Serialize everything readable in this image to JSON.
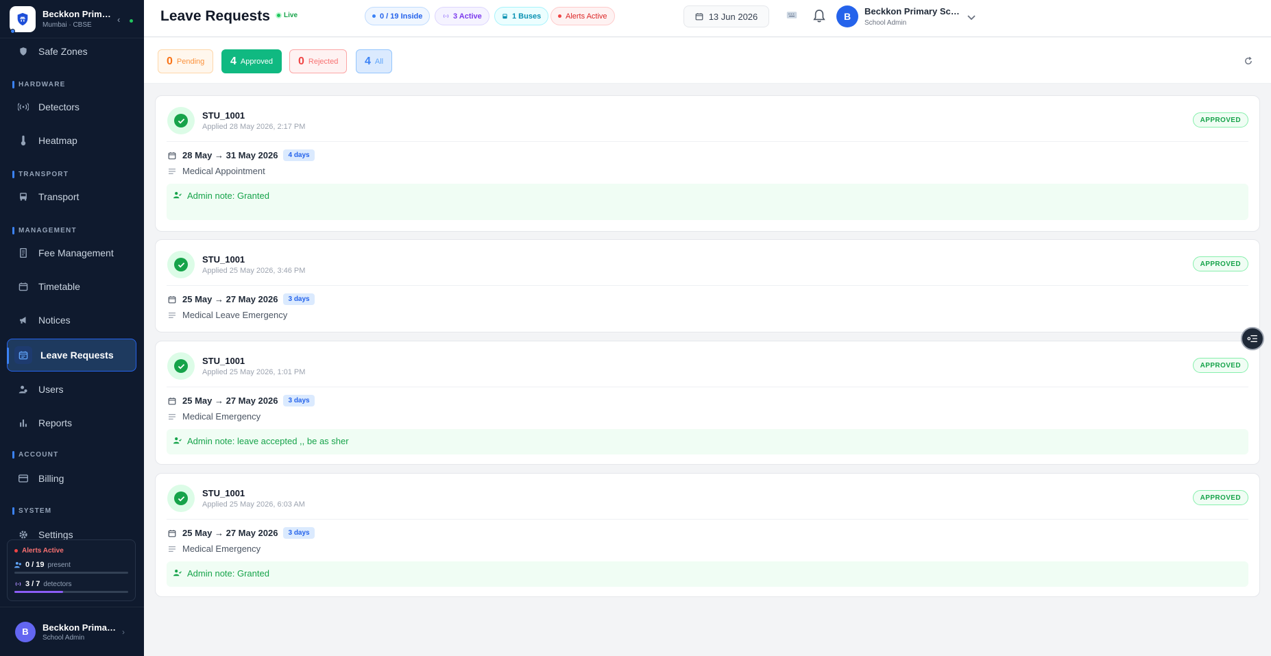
{
  "sidebar": {
    "school_name": "Beckkon Primary School",
    "school_meta": "Mumbai · CBSE",
    "sections": {
      "hardware": "HARDWARE",
      "transport": "TRANSPORT",
      "management": "MANAGEMENT",
      "account": "ACCOUNT",
      "system": "SYSTEM"
    },
    "items": {
      "safe_zones": "Safe Zones",
      "detectors": "Detectors",
      "heatmap": "Heatmap",
      "transport": "Transport",
      "fee_management": "Fee Management",
      "timetable": "Timetable",
      "notices": "Notices",
      "leave_requests": "Leave Requests",
      "users": "Users",
      "reports": "Reports",
      "billing": "Billing",
      "settings": "Settings"
    },
    "status": {
      "alert": "Alerts Active",
      "present_value": "0 / 19",
      "present_label": "present",
      "present_fraction": 0.0,
      "detectors_value": "3 / 7",
      "detectors_label": "detectors",
      "detectors_fraction": 0.43
    },
    "user": {
      "initial": "B",
      "name": "Beckkon Primary School",
      "role": "School Admin"
    }
  },
  "header": {
    "title": "Leave Requests",
    "live": "Live",
    "chips": {
      "inside": "0 / 19 Inside",
      "active": "3 Active",
      "buses": "1 Buses",
      "alerts": "Alerts Active"
    },
    "date": "13 Jun 2026",
    "user_initial": "B",
    "user_name": "Beckkon Primary School",
    "user_role": "School Admin"
  },
  "filters": {
    "pending": {
      "count": "0",
      "label": "Pending"
    },
    "approved": {
      "count": "4",
      "label": "Approved"
    },
    "rejected": {
      "count": "0",
      "label": "Rejected"
    },
    "all": {
      "count": "4",
      "label": "All"
    }
  },
  "requests": [
    {
      "student": "STU_1001",
      "applied": "Applied 28 May 2026, 2:17 PM",
      "status": "APPROVED",
      "dates": "28 May → 31 May 2026",
      "days": "4 days",
      "reason": "Medical Appointment",
      "note": "Admin note: Granted"
    },
    {
      "student": "STU_1001",
      "applied": "Applied 25 May 2026, 3:46 PM",
      "status": "APPROVED",
      "dates": "25 May → 27 May 2026",
      "days": "3 days",
      "reason": "Medical Leave Emergency",
      "note": ""
    },
    {
      "student": "STU_1001",
      "applied": "Applied 25 May 2026, 1:01 PM",
      "status": "APPROVED",
      "dates": "25 May → 27 May 2026",
      "days": "3 days",
      "reason": "Medical Emergency",
      "note": "Admin note: leave accepted ,, be as sher"
    },
    {
      "student": "STU_1001",
      "applied": "Applied 25 May 2026, 6:03 AM",
      "status": "APPROVED",
      "dates": "25 May → 27 May 2026",
      "days": "3 days",
      "reason": "Medical Emergency",
      "note": "Admin note: Granted"
    }
  ],
  "colors": {
    "sidebar_bg": "#0f1a2e",
    "accent": "#2563eb",
    "approved": "#16a34a",
    "pending": "#f97316",
    "rejected": "#ef4444"
  }
}
